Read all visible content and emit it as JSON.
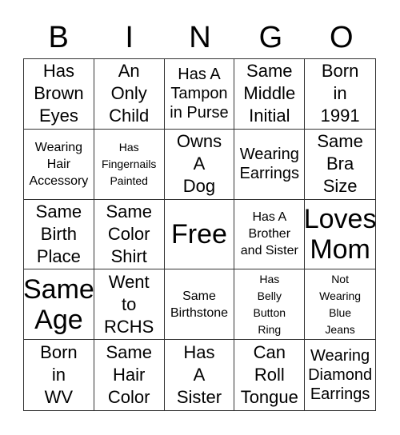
{
  "header": {
    "letters": [
      "B",
      "I",
      "N",
      "G",
      "O"
    ]
  },
  "board": {
    "cells": [
      {
        "text": "Has\nBrown\nEyes",
        "size": "l"
      },
      {
        "text": "An\nOnly\nChild",
        "size": "l"
      },
      {
        "text": "Has A\nTampon\nin Purse",
        "size": "m"
      },
      {
        "text": "Same\nMiddle\nInitial",
        "size": "l"
      },
      {
        "text": "Born\nin\n1991",
        "size": "l"
      },
      {
        "text": "Wearing\nHair\nAccessory",
        "size": "s"
      },
      {
        "text": "Has\nFingernails\nPainted",
        "size": "xs"
      },
      {
        "text": "Owns\nA\nDog",
        "size": "l"
      },
      {
        "text": "Wearing\nEarrings",
        "size": "m"
      },
      {
        "text": "Same\nBra\nSize",
        "size": "l"
      },
      {
        "text": "Same\nBirth\nPlace",
        "size": "l"
      },
      {
        "text": "Same\nColor\nShirt",
        "size": "l"
      },
      {
        "text": "Free",
        "size": "xl"
      },
      {
        "text": "Has A\nBrother\nand Sister",
        "size": "s"
      },
      {
        "text": "Loves\nMom",
        "size": "xl"
      },
      {
        "text": "Same\nAge",
        "size": "xl"
      },
      {
        "text": "Went\nto\nRCHS",
        "size": "l"
      },
      {
        "text": "Same\nBirthstone",
        "size": "s"
      },
      {
        "text": "Has\nBelly\nButton\nRing",
        "size": "xs"
      },
      {
        "text": "Not\nWearing\nBlue\nJeans",
        "size": "xs"
      },
      {
        "text": "Born\nin\nWV",
        "size": "l"
      },
      {
        "text": "Same\nHair\nColor",
        "size": "l"
      },
      {
        "text": "Has\nA\nSister",
        "size": "l"
      },
      {
        "text": "Can\nRoll\nTongue",
        "size": "l"
      },
      {
        "text": "Wearing\nDiamond\nEarrings",
        "size": "m"
      }
    ]
  }
}
